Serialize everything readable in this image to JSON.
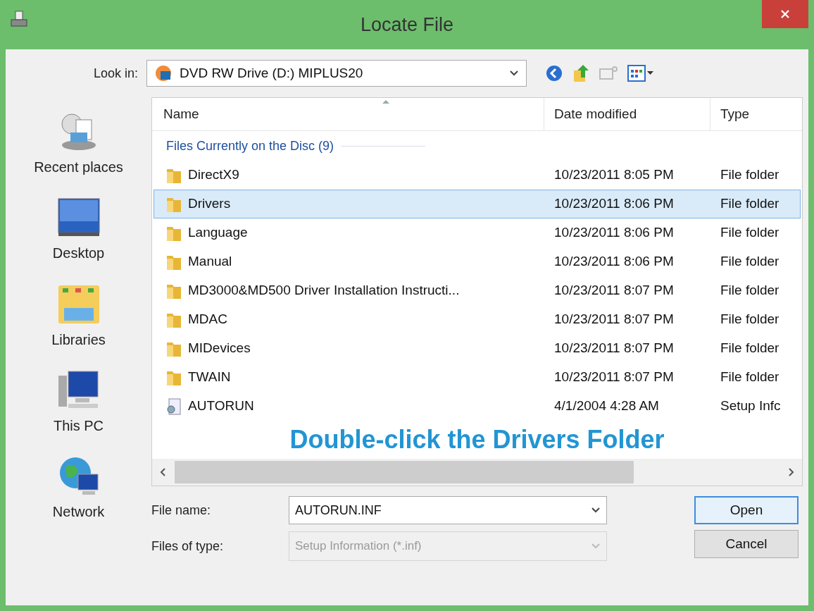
{
  "window": {
    "title": "Locate File"
  },
  "look_in": {
    "label": "Look in:",
    "value": "DVD RW Drive (D:) MIPLUS20"
  },
  "sidebar": {
    "items": [
      {
        "label": "Recent places",
        "kind": "recent"
      },
      {
        "label": "Desktop",
        "kind": "desktop"
      },
      {
        "label": "Libraries",
        "kind": "libraries"
      },
      {
        "label": "This PC",
        "kind": "pc"
      },
      {
        "label": "Network",
        "kind": "network"
      }
    ]
  },
  "table": {
    "columns": [
      "Name",
      "Date modified",
      "Type"
    ],
    "group": "Files Currently on the Disc (9)",
    "rows": [
      {
        "name": "DirectX9",
        "date": "10/23/2011 8:05 PM",
        "type": "File folder",
        "kind": "folder",
        "selected": false
      },
      {
        "name": "Drivers",
        "date": "10/23/2011 8:06 PM",
        "type": "File folder",
        "kind": "folder",
        "selected": true
      },
      {
        "name": "Language",
        "date": "10/23/2011 8:06 PM",
        "type": "File folder",
        "kind": "folder",
        "selected": false
      },
      {
        "name": "Manual",
        "date": "10/23/2011 8:06 PM",
        "type": "File folder",
        "kind": "folder",
        "selected": false
      },
      {
        "name": "MD3000&MD500 Driver Installation Instructi...",
        "date": "10/23/2011 8:07 PM",
        "type": "File folder",
        "kind": "folder",
        "selected": false
      },
      {
        "name": "MDAC",
        "date": "10/23/2011 8:07 PM",
        "type": "File folder",
        "kind": "folder",
        "selected": false
      },
      {
        "name": "MIDevices",
        "date": "10/23/2011 8:07 PM",
        "type": "File folder",
        "kind": "folder",
        "selected": false
      },
      {
        "name": "TWAIN",
        "date": "10/23/2011 8:07 PM",
        "type": "File folder",
        "kind": "folder",
        "selected": false
      },
      {
        "name": "AUTORUN",
        "date": "4/1/2004 4:28 AM",
        "type": "Setup Infc",
        "kind": "file",
        "selected": false
      }
    ]
  },
  "annotation": "Double-click the Drivers Folder",
  "file_name": {
    "label": "File name:",
    "value": "AUTORUN.INF"
  },
  "file_type": {
    "label": "Files of type:",
    "value": "Setup Information (*.inf)",
    "disabled": true
  },
  "buttons": [
    {
      "label": "Open",
      "default": true
    },
    {
      "label": "Cancel",
      "default": false
    }
  ]
}
